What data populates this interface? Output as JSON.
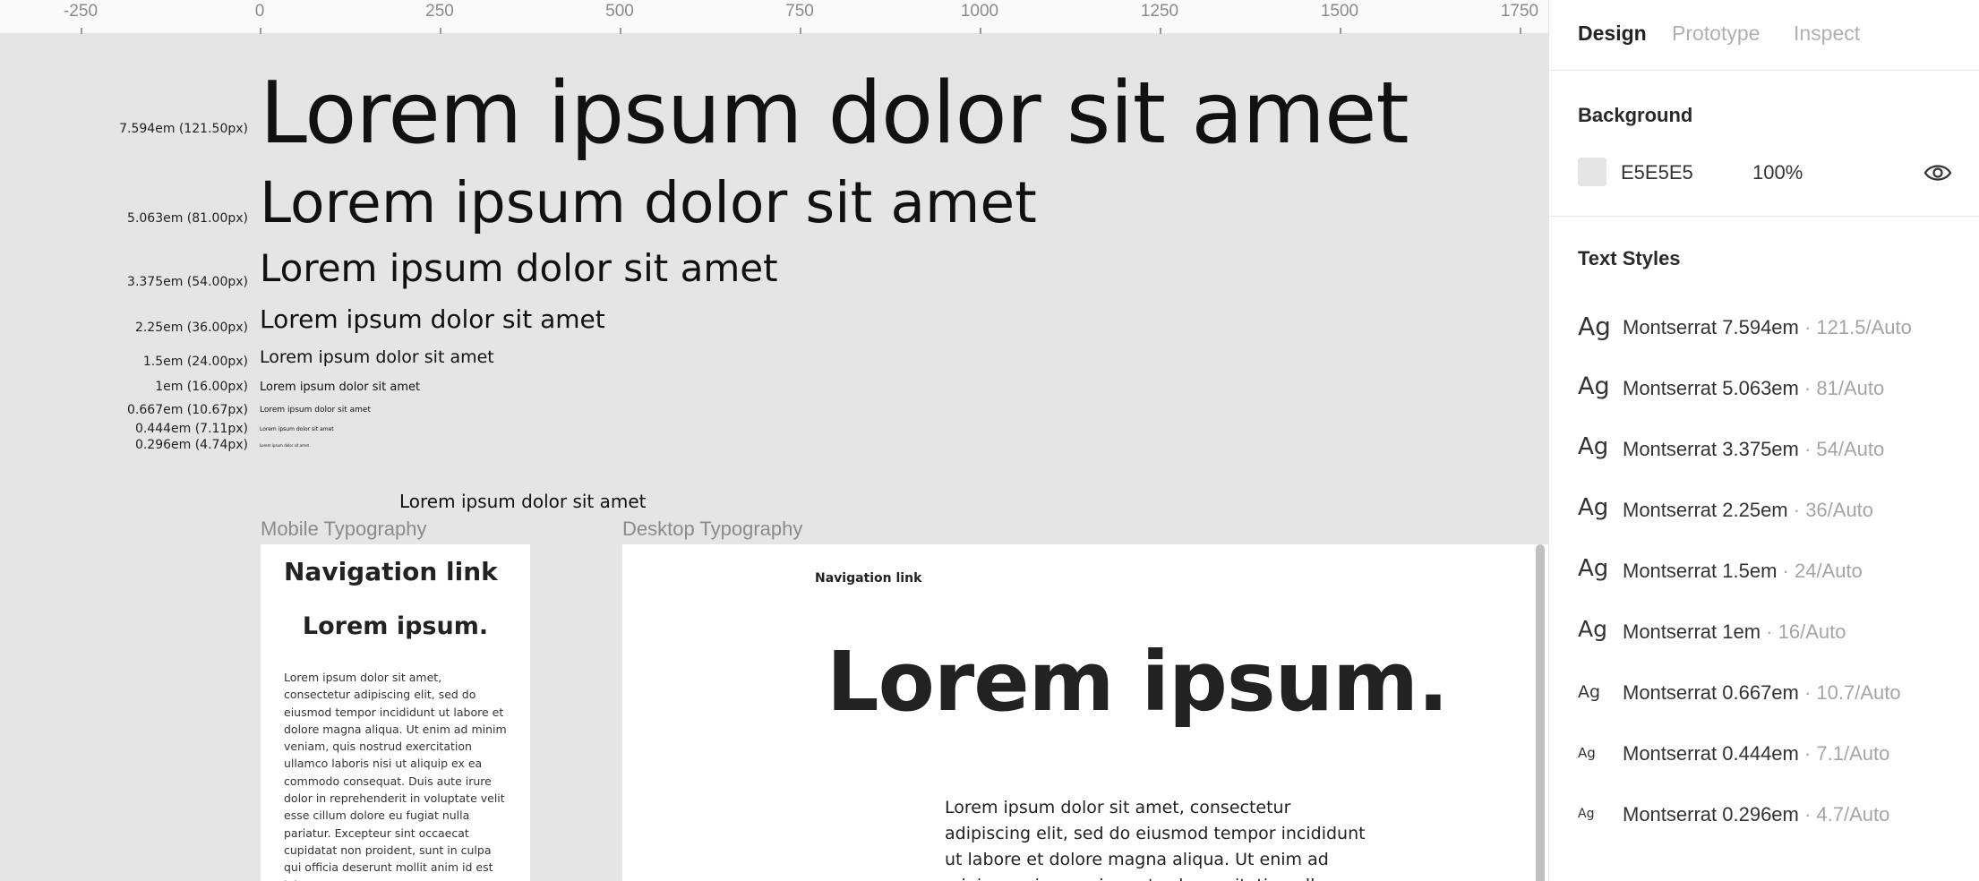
{
  "ruler": {
    "ticks": [
      "-250",
      "0",
      "250",
      "500",
      "750",
      "1000",
      "1250",
      "1500",
      "1750"
    ]
  },
  "type_scale": [
    {
      "label": "7.594em (121.50px)",
      "sample": "Lorem ipsum dolor sit amet"
    },
    {
      "label": "5.063em (81.00px)",
      "sample": "Lorem ipsum dolor sit amet"
    },
    {
      "label": "3.375em (54.00px)",
      "sample": "Lorem ipsum dolor sit amet"
    },
    {
      "label": "2.25em (36.00px)",
      "sample": "Lorem ipsum dolor sit amet"
    },
    {
      "label": "1.5em (24.00px)",
      "sample": "Lorem ipsum dolor sit amet"
    },
    {
      "label": "1em (16.00px)",
      "sample": "Lorem ipsum dolor sit amet"
    },
    {
      "label": "0.667em (10.67px)",
      "sample": "Lorem ipsum dolor sit amet"
    },
    {
      "label": "0.444em (7.11px)",
      "sample": "Lorem ipsum dolor sit amet"
    },
    {
      "label": "0.296em (4.74px)",
      "sample": "Lorem ipsum dolor sit amet"
    }
  ],
  "canvas": {
    "floating_text": "Lorem ipsum dolor sit amet",
    "mobile_title": "Mobile Typography",
    "desktop_title": "Desktop Typography",
    "mobile": {
      "nav": "Navigation link",
      "heading": "Lorem ipsum.",
      "body": "Lorem ipsum dolor sit amet, consectetur adipiscing elit, sed do eiusmod tempor incididunt ut labore et dolore magna aliqua. Ut enim ad minim veniam, quis nostrud exercitation ullamco laboris nisi ut aliquip ex ea commodo consequat. Duis aute irure dolor in reprehenderit in voluptate velit esse cillum dolore eu fugiat nulla pariatur. Excepteur sint occaecat cupidatat non proident, sunt in culpa qui officia deserunt mollit anim id est laborum."
    },
    "desktop": {
      "nav": "Navigation link",
      "heading": "Lorem ipsum.",
      "body": "Lorem ipsum dolor sit amet, consectetur adipiscing elit, sed do eiusmod tempor incididunt ut labore et dolore magna aliqua. Ut enim ad minim veniam, quis nostrud exercitation ullamco laboris nisi ut aliquip ex ea commodo consequat."
    }
  },
  "panel": {
    "tabs": [
      "Design",
      "Prototype",
      "Inspect"
    ],
    "active_tab": "Design",
    "background": {
      "title": "Background",
      "hex": "E5E5E5",
      "opacity": "100%",
      "visibility_icon": "eye-icon",
      "color": "#E5E5E5"
    },
    "text_styles": {
      "title": "Text Styles",
      "items": [
        {
          "ag": "Ag",
          "name": "Montserrat 7.594em",
          "meta": " · 121.5/Auto"
        },
        {
          "ag": "Ag",
          "name": "Montserrat 5.063em",
          "meta": " · 81/Auto"
        },
        {
          "ag": "Ag",
          "name": "Montserrat 3.375em",
          "meta": " · 54/Auto"
        },
        {
          "ag": "Ag",
          "name": "Montserrat 2.25em",
          "meta": " · 36/Auto"
        },
        {
          "ag": "Ag",
          "name": "Montserrat 1.5em",
          "meta": " · 24/Auto"
        },
        {
          "ag": "Ag",
          "name": "Montserrat 1em",
          "meta": " · 16/Auto"
        },
        {
          "ag": "Ag",
          "name": "Montserrat 0.667em",
          "meta": " · 10.7/Auto"
        },
        {
          "ag": "Ag",
          "name": "Montserrat 0.444em",
          "meta": " · 7.1/Auto"
        },
        {
          "ag": "Ag",
          "name": "Montserrat 0.296em",
          "meta": " · 4.7/Auto"
        }
      ]
    }
  }
}
